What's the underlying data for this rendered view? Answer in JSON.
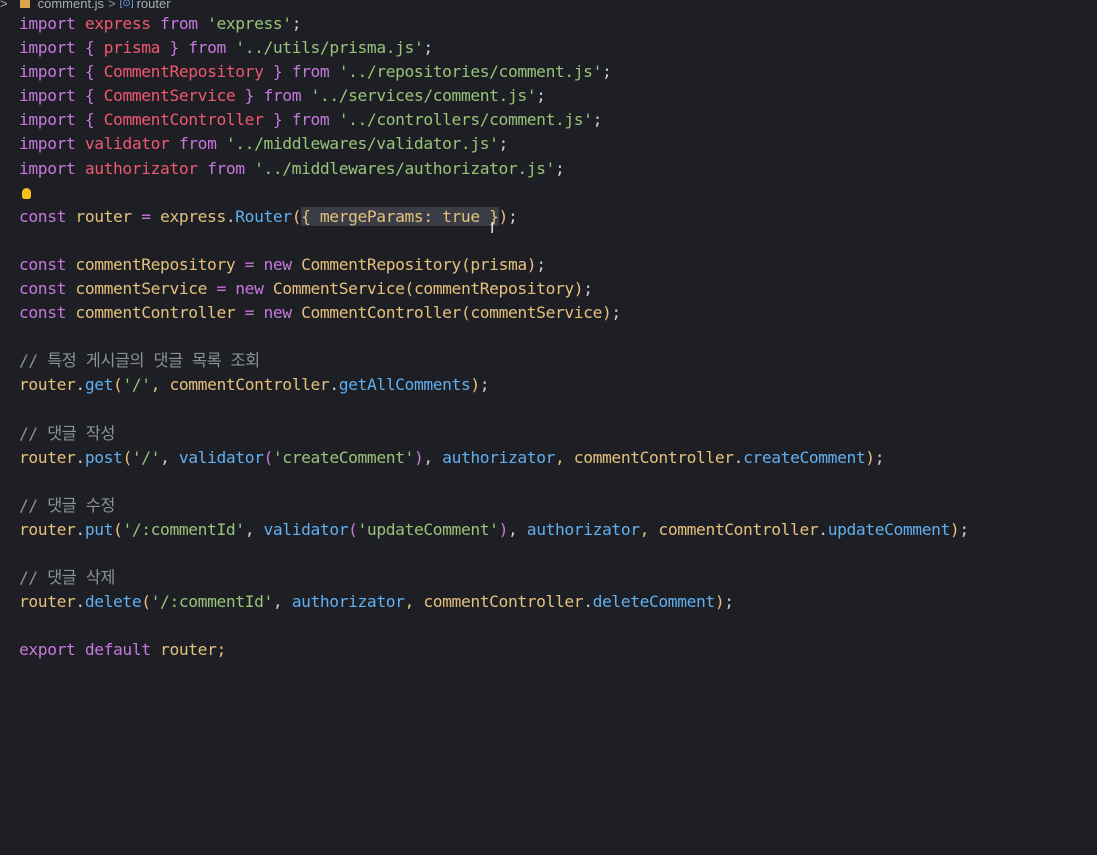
{
  "breadcrumb": {
    "chevron": ">",
    "file": "comment.js",
    "separator": ">",
    "symbol_icon": "[⊙]",
    "symbol": "router",
    "file_icon": "js-file-icon"
  },
  "code": {
    "l1": {
      "a": "import",
      "b": " express ",
      "c": "from",
      "d": " ",
      "e": "'express'",
      "f": ";"
    },
    "l2": {
      "a": "import",
      "b": " { ",
      "c": "prisma",
      "d": " } ",
      "e": "from",
      "f": " ",
      "g": "'../utils/prisma.js'",
      "h": ";"
    },
    "l3": {
      "a": "import",
      "b": " { ",
      "c": "CommentRepository",
      "d": " } ",
      "e": "from",
      "f": " ",
      "g": "'../repositories/comment.js'",
      "h": ";"
    },
    "l4": {
      "a": "import",
      "b": " { ",
      "c": "CommentService",
      "d": " } ",
      "e": "from",
      "f": " ",
      "g": "'../services/comment.js'",
      "h": ";"
    },
    "l5": {
      "a": "import",
      "b": " { ",
      "c": "CommentController",
      "d": " } ",
      "e": "from",
      "f": " ",
      "g": "'../controllers/comment.js'",
      "h": ";"
    },
    "l6": {
      "a": "import",
      "b": " validator ",
      "c": "from",
      "d": " ",
      "e": "'../middlewares/validator.js'",
      "f": ";"
    },
    "l7": {
      "a": "import",
      "b": " authorizator ",
      "c": "from",
      "d": " ",
      "e": "'../middlewares/authorizator.js'",
      "f": ";"
    },
    "l9": {
      "a": "const",
      "b": " router ",
      "c": "=",
      "d": " express",
      "e": ".",
      "f": "Router",
      "g": "(",
      "h": "{ mergeParams: true }",
      "i": ")",
      ";": ";",
      "j": ";"
    },
    "l11": {
      "a": "const",
      "b": " commentRepository ",
      "c": "=",
      "d": " ",
      "e": "new",
      "f": " CommentRepository",
      "g": "(",
      "h": "prisma",
      "i": ")",
      "j": ";"
    },
    "l12": {
      "a": "const",
      "b": " commentService ",
      "c": "=",
      "d": " ",
      "e": "new",
      "f": " CommentService",
      "g": "(",
      "h": "commentRepository",
      "i": ")",
      "j": ";"
    },
    "l13": {
      "a": "const",
      "b": " commentController ",
      "c": "=",
      "d": " ",
      "e": "new",
      "f": " CommentController",
      "g": "(",
      "h": "commentService",
      "i": ")",
      "j": ";"
    },
    "l15": "// 특정 게시글의 댓글 목록 조회",
    "l16": {
      "a": "router",
      ".": ".",
      "b": "get",
      "c": "(",
      "d": "'/'",
      "e": ", commentController",
      "f": ".",
      "g": "getAllComments",
      "h": ")",
      "i": ";"
    },
    "l18": "// 댓글 작성",
    "l19": {
      "a": "router",
      "b": ".",
      "c": "post",
      "d": "(",
      "e": "'/'",
      "f": ", ",
      "g": "validator",
      "h": "(",
      "i": "'createComment'",
      "j": ")",
      "k": ", ",
      "l": "authorizator",
      "m": ", commentController",
      "n": ".",
      "o": "createComment",
      "p": ")",
      "q": ";"
    },
    "l21": "// 댓글 수정",
    "l22": {
      "a": "router",
      "b": ".",
      "c": "put",
      "d": "(",
      "e": "'/:commentId'",
      "f": ", ",
      "g": "validator",
      "h": "(",
      "i": "'updateComment'",
      "j": ")",
      "k": ", ",
      "l": "authorizator",
      "m": ", commentController",
      "n": ".",
      "o": "updateComment",
      "p": ")",
      "q": ";"
    },
    "l24": "// 댓글 삭제",
    "l25": {
      "a": "router",
      "b": ".",
      "c": "delete",
      "d": "(",
      "e": "'/:commentId'",
      "f": ", ",
      "g": "authorizator",
      "h": ", commentController",
      "i": ".",
      "j": "deleteComment",
      "k": ")",
      "l": ";"
    },
    "l27": {
      "a": "export",
      "b": " ",
      "c": "default",
      "d": " router;"
    }
  },
  "icons": {
    "lightbulb": "lightbulb-icon",
    "text_cursor": "I"
  },
  "colors": {
    "background": "#1e1f24",
    "keyword": "#c678dd",
    "identifier": "#ef596f",
    "string": "#98c379",
    "function": "#61afef",
    "variable": "#e5c07b",
    "comment": "#8b909a",
    "highlight": "#3a3d46"
  }
}
